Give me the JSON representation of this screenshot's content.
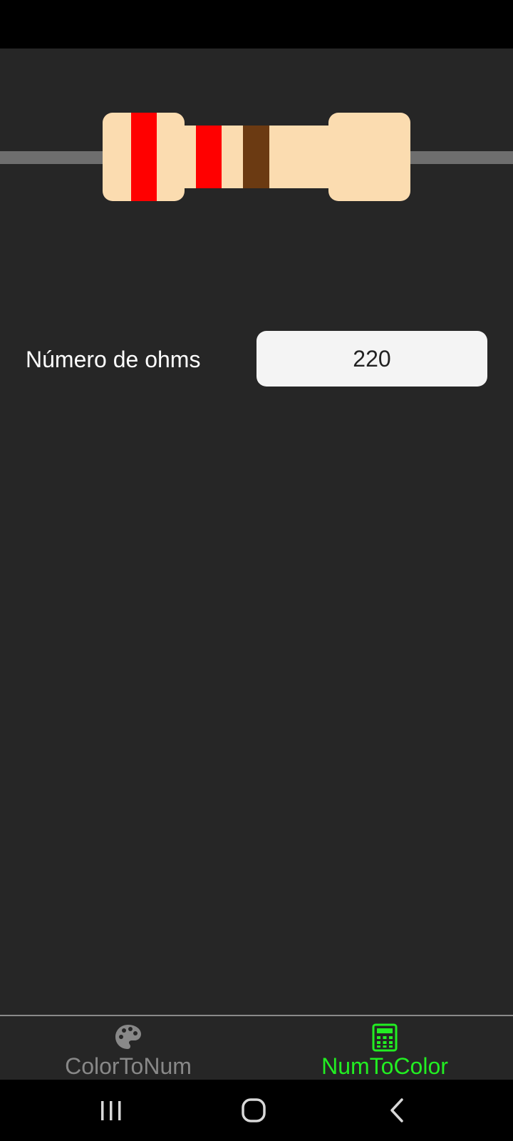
{
  "resistor": {
    "body_color": "#fbdcb0",
    "lead_color": "#6e6e6e",
    "bands": [
      {
        "color": "#ff0000"
      },
      {
        "color": "#ff0000"
      },
      {
        "color": "#6b3a12"
      }
    ]
  },
  "form": {
    "label": "Número de ohms",
    "value": "220"
  },
  "tabs": [
    {
      "label": "ColorToNum",
      "icon": "palette-icon",
      "active": false,
      "color": "#888888"
    },
    {
      "label": "NumToColor",
      "icon": "calculator-icon",
      "active": true,
      "color": "#22ee22"
    }
  ],
  "nav": {
    "buttons": [
      "recent-apps-icon",
      "home-icon",
      "back-icon"
    ]
  }
}
